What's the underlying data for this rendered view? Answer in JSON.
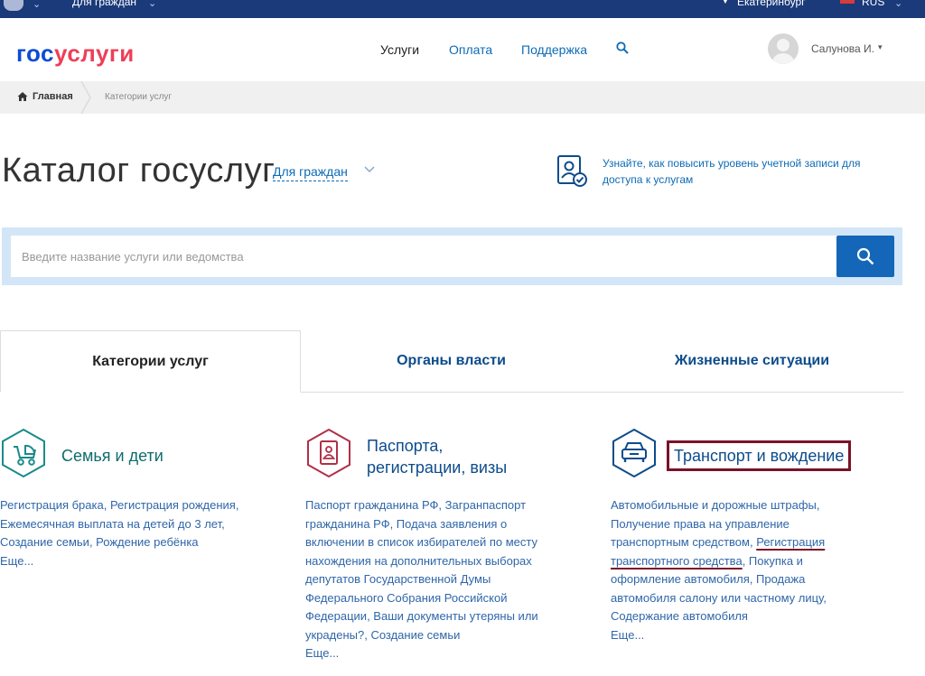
{
  "topbar": {
    "citizens_label": "Для граждан",
    "city": "Екатеринбург",
    "language": "RUS"
  },
  "header": {
    "logo_part1": "гос",
    "logo_part2": "услуги",
    "nav": [
      "Услуги",
      "Оплата",
      "Поддержка"
    ],
    "user_name": "Салунова И.",
    "user_caret": "▾"
  },
  "breadcrumb": {
    "home": "Главная",
    "current": "Категории услуг"
  },
  "catalog": {
    "title": "Каталог госуслуг",
    "audience": "Для граждан",
    "level_hint": "Узнайте, как повысить уровень учетной записи для доступа к услугам"
  },
  "search": {
    "placeholder": "Введите название услуги или ведомства"
  },
  "tabs": [
    "Категории услуг",
    "Органы власти",
    "Жизненные ситуации"
  ],
  "categories": [
    {
      "title": "Семья и дети",
      "desc_lines": [
        "Регистрация брака, Регистрация рождения,",
        "Ежемесячная выплата на детей до 3 лет,",
        "Создание семьи, Рождение ребёнка"
      ],
      "more": "Еще..."
    },
    {
      "title_line1": "Паспорта,",
      "title_line2": "регистрации, визы",
      "desc_lines": [
        "Паспорт гражданина РФ, Загранпаспорт",
        "гражданина РФ, Подача заявления о",
        "включении в список избирателей по месту",
        "нахождения на дополнительных выборах",
        "депутатов Государственной Думы",
        "Федерального Собрания Российской",
        "Федерации, Ваши документы утеряны или",
        "украдены?, Создание семьи"
      ],
      "more": "Еще..."
    },
    {
      "title": "Транспорт и вождение",
      "desc_line1": "Автомобильные и дорожные штрафы,",
      "desc_line2": "Получение права на управление",
      "desc_line3_a": "транспортным средством,",
      "desc_line3_b": "Регистрация",
      "desc_line4_a": "транспортного средства",
      "desc_line4_b": ", Покупка и",
      "desc_line5": "оформление автомобиля, Продажа",
      "desc_line6": "автомобиля салону или частному лицу,",
      "desc_line7": "Содержание автомобиля",
      "more": "Еще..."
    }
  ],
  "colors": {
    "topbar": "#1b3a7a",
    "brand_blue": "#0d4cd3",
    "brand_red": "#ee3f58",
    "link": "#0d6bb5",
    "search_button": "#1466b8",
    "family_teal": "#0f6c6c",
    "passport_red": "#b03048",
    "highlight": "#7a1229"
  }
}
